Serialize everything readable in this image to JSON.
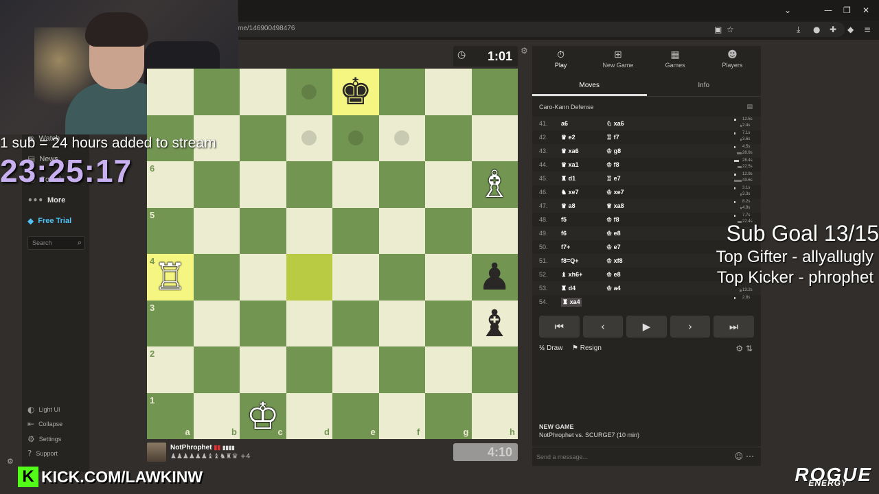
{
  "browser": {
    "url": "me/146900498476"
  },
  "sidebar": {
    "items_top": [
      "Watch",
      "News",
      "Social"
    ],
    "more": "More",
    "free_trial": "Free Trial",
    "search_placeholder": "Search",
    "bottom": [
      "Light UI",
      "Collapse",
      "Settings",
      "Support"
    ]
  },
  "overlay": {
    "sub_promo": "1 sub = 24 hours added to stream",
    "sub_timer": "23:25:17",
    "goal_title": "Sub Goal 13/15",
    "top_gifter": "Top Gifter - allyallugly",
    "top_kicker": "Top Kicker - phrophet",
    "kick_url": "KICK.COM/LAWKINW",
    "brand": "ROGUE",
    "brand_sub": "ENERGY"
  },
  "game": {
    "timer_top": "1:01",
    "timer_bottom": "4:10",
    "player_name": "NotPhrophet",
    "player_extra": "+4",
    "ranks": [
      "6",
      "5",
      "4",
      "3",
      "2",
      "1"
    ],
    "files": [
      "a",
      "b",
      "c",
      "d",
      "e",
      "f",
      "g",
      "h"
    ]
  },
  "panel": {
    "nav": [
      "Play",
      "New Game",
      "Games",
      "Players"
    ],
    "tabs": [
      "Moves",
      "Info"
    ],
    "opening": "Caro-Kann Defense",
    "moves": [
      {
        "n": "41.",
        "w": "a6",
        "b": "♘ xa6"
      },
      {
        "n": "42.",
        "w": "♛ e2",
        "b": "♖ f7"
      },
      {
        "n": "43.",
        "w": "♛ xa6",
        "b": "♔ g8"
      },
      {
        "n": "44.",
        "w": "♛ xa1",
        "b": "♔ f8"
      },
      {
        "n": "45.",
        "w": "♜ d1",
        "b": "♖ e7"
      },
      {
        "n": "46.",
        "w": "♞ xe7",
        "b": "♔ xe7"
      },
      {
        "n": "47.",
        "w": "♛ a8",
        "b": "♕ xa8"
      },
      {
        "n": "48.",
        "w": "f5",
        "b": "♔ f8"
      },
      {
        "n": "49.",
        "w": "f6",
        "b": "♔ e8"
      },
      {
        "n": "50.",
        "w": "f7+",
        "b": "♔ e7"
      },
      {
        "n": "51.",
        "w": "f8=Q+",
        "b": "♔ xf8"
      },
      {
        "n": "52.",
        "w": "♝ xh6+",
        "b": "♔ e8"
      },
      {
        "n": "53.",
        "w": "♜ d4",
        "b": "♔ a4"
      },
      {
        "n": "54.",
        "w": "♜ xa4",
        "b": ""
      }
    ],
    "times": [
      [
        "12.5s",
        "2.4s"
      ],
      [
        "7.1s",
        "3.6s"
      ],
      [
        "4.5s",
        "28.9s"
      ],
      [
        "28.4s",
        "22.5s"
      ],
      [
        "12.9s",
        "43.6s"
      ],
      [
        "3.1s",
        "3.3s"
      ],
      [
        "8.2s",
        "4.9s"
      ],
      [
        "7.7s",
        "22.4s"
      ],
      [
        "",
        ""
      ],
      [
        "",
        ""
      ],
      [
        "",
        ""
      ],
      [
        "",
        ""
      ],
      [
        "",
        "13.2s"
      ],
      [
        "2.8s",
        ""
      ]
    ],
    "controls": [
      "⏮",
      "‹",
      "▶",
      "›",
      "⏭"
    ],
    "draw": "Draw",
    "resign": "Resign",
    "newgame_title": "NEW GAME",
    "newgame_desc": "NotPhrophet vs. SCURGE7 (10 min)",
    "chat_placeholder": "Send a message..."
  },
  "colors": {
    "board_light": "#ebecd0",
    "board_dark": "#739552",
    "highlight": "#f5f682",
    "timer_purple": "#c8b0f0",
    "kick_green": "#53fc18"
  }
}
